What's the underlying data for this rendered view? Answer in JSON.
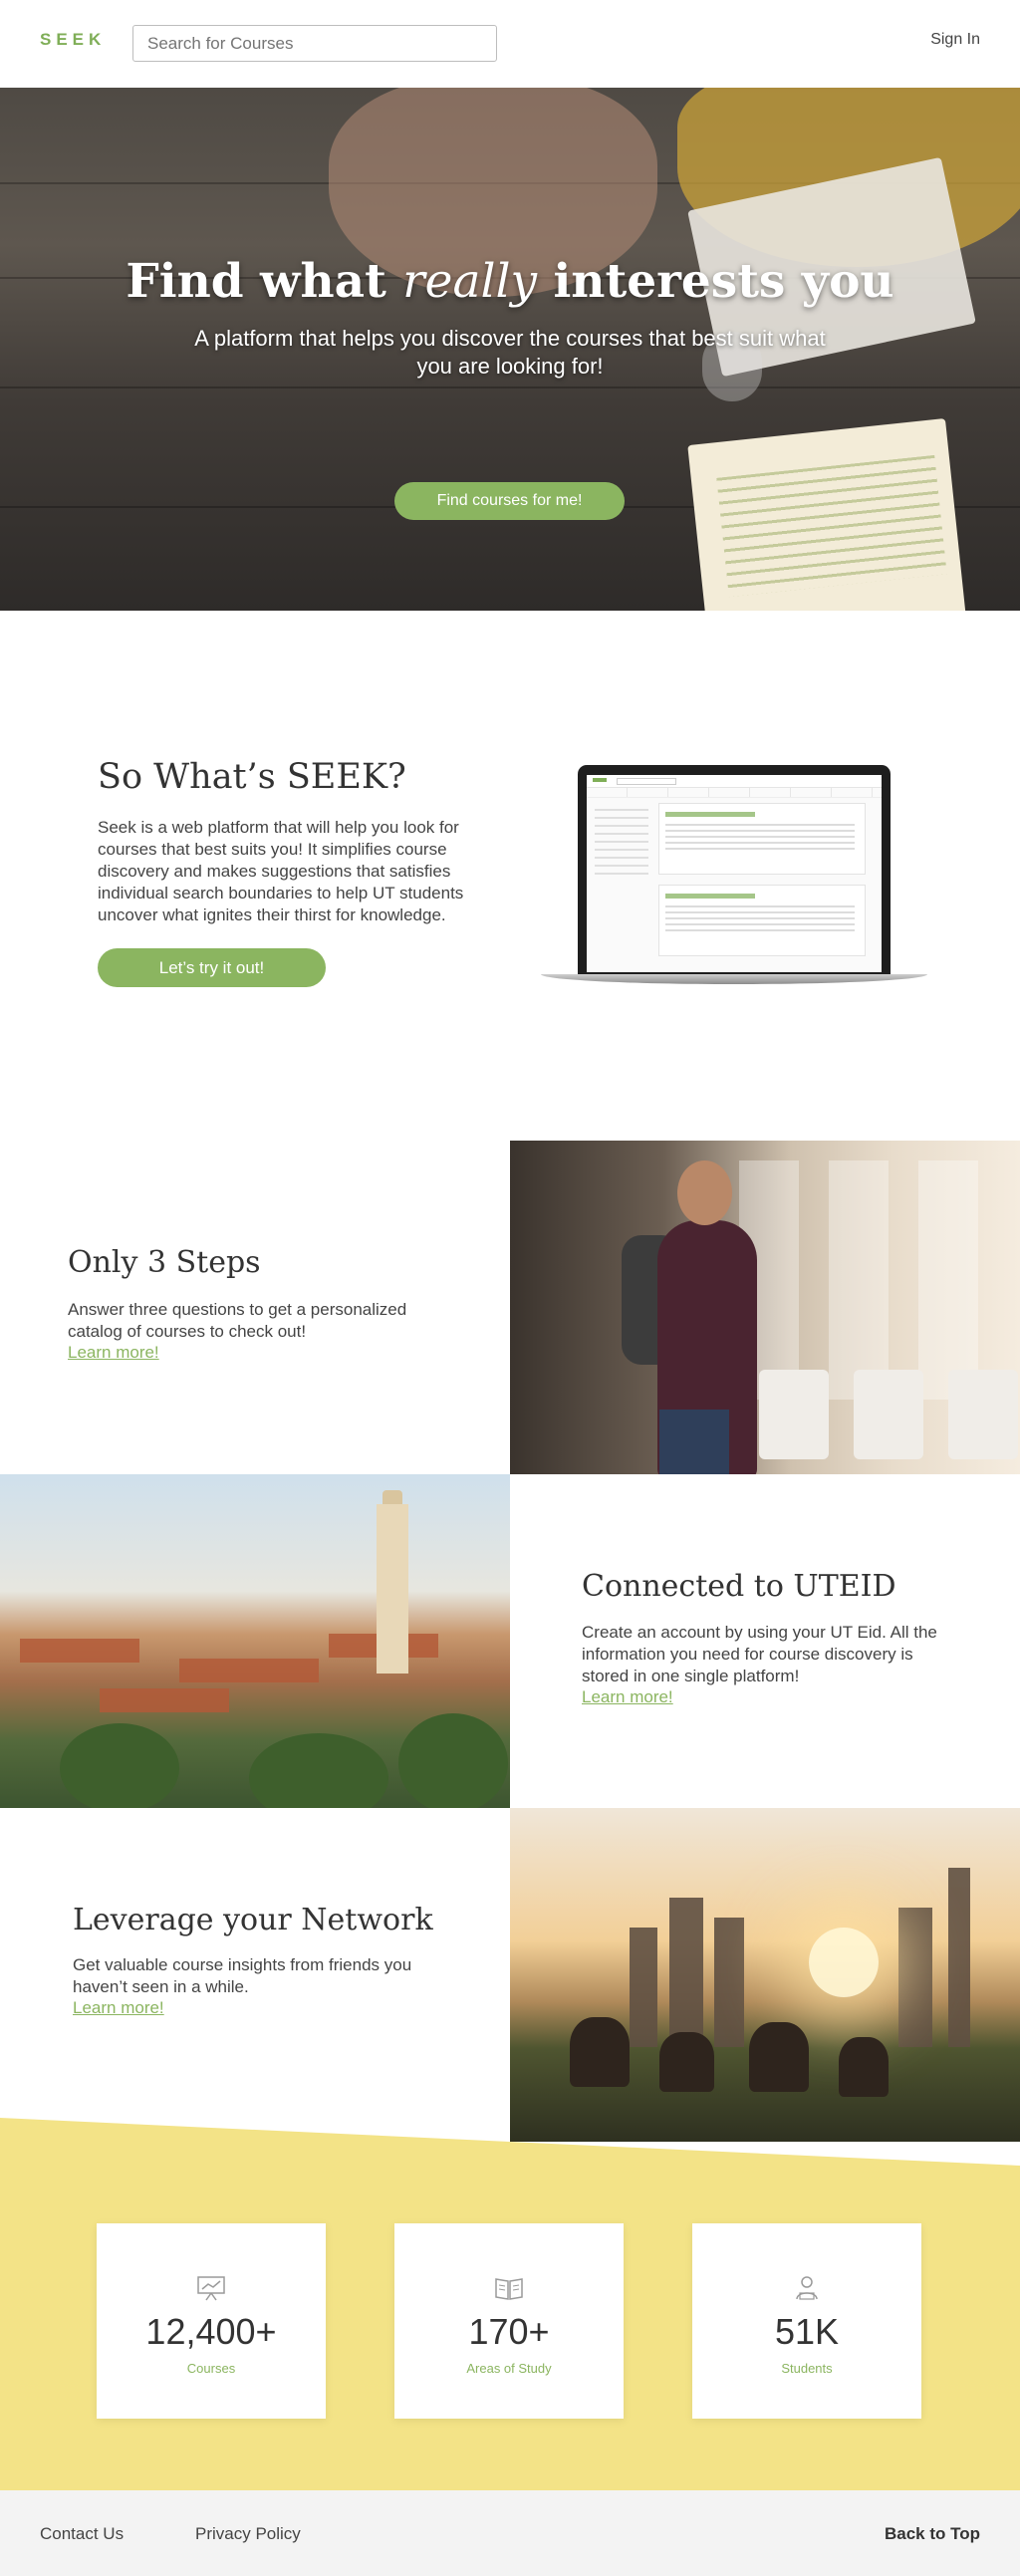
{
  "header": {
    "logo": "SEEK",
    "search_placeholder": "Search for Courses",
    "signin": "Sign In"
  },
  "hero": {
    "title_pre": "Find what ",
    "title_em": "really",
    "title_post": " interests you",
    "subtitle": "A platform that helps you discover the courses that best suit what you are looking for!",
    "button": "Find courses for me!"
  },
  "about": {
    "title": "So What’s SEEK?",
    "text": "Seek is a web platform that will help you look for courses that best suits you! It simplifies course discovery and makes suggestions that satisfies individual search boundaries to help UT students uncover what ignites their thirst for knowledge.",
    "button": "Let’s try it out!"
  },
  "features": [
    {
      "title": "Only 3 Steps",
      "text": "Answer three questions to get a personalized catalog of courses to check out!",
      "link": "Learn more!"
    },
    {
      "title": "Connected to UTEID",
      "text": "Create an account by using your UT Eid. All the information you need for course discovery is stored in one single platform!",
      "link": "Learn more!"
    },
    {
      "title": "Leverage your Network",
      "text": "Get valuable course insights from friends you haven’t seen in a while.",
      "link": "Learn more!"
    }
  ],
  "stats": [
    {
      "icon": "presentation-icon",
      "value": "12,400+",
      "label": "Courses"
    },
    {
      "icon": "book-icon",
      "value": "170+",
      "label": "Areas of Study"
    },
    {
      "icon": "student-icon",
      "value": "51K",
      "label": "Students"
    }
  ],
  "footer": {
    "contact": "Contact Us",
    "privacy": "Privacy Policy",
    "back_to_top": "Back to Top"
  },
  "colors": {
    "accent_green": "#8bb560",
    "stats_yellow": "#f3e387",
    "footer_gray": "#f3f3f3"
  }
}
